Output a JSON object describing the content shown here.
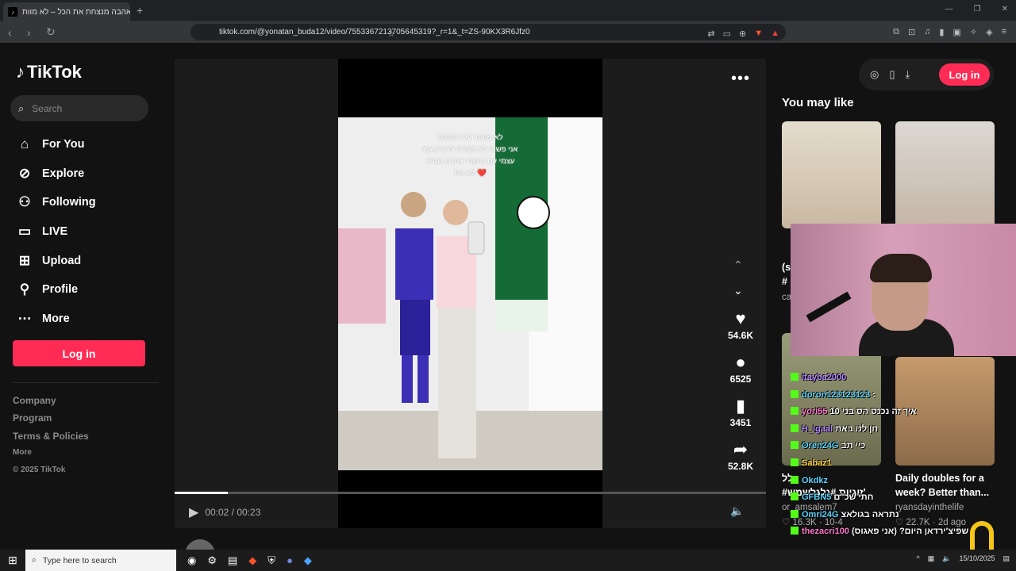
{
  "browser": {
    "tab_title": "אהבה מנצחת את הכל – לא מוות",
    "tab_icon": "tiktok-favicon",
    "url": "tiktok.com/@yonatan_buda12/video/7553367213705645319?_r=1&_t=ZS-90KX3R6Jfz0"
  },
  "sidebar": {
    "logo": "TikTok",
    "search_placeholder": "Search",
    "menu": [
      {
        "label": "For You",
        "icon": "home-icon"
      },
      {
        "label": "Explore",
        "icon": "compass-icon"
      },
      {
        "label": "Following",
        "icon": "following-icon"
      },
      {
        "label": "LIVE",
        "icon": "live-icon"
      },
      {
        "label": "Upload",
        "icon": "upload-icon"
      },
      {
        "label": "Profile",
        "icon": "profile-icon"
      },
      {
        "label": "More",
        "icon": "more-icon"
      }
    ],
    "login_label": "Log in",
    "footer": [
      "Company",
      "Program",
      "Terms & Policies",
      "More",
      "© 2025 TikTok"
    ]
  },
  "video": {
    "caption_lines": [
      "לא מוותר עליו לעולם",
      "אני פשוט לא מצליח לדמיין את",
      "עצמי עם מישהי אחרת שהיא",
      "לא את ❤️"
    ],
    "likes": "54.6K",
    "comments": "6525",
    "saves": "3451",
    "shares": "52.8K",
    "time": "00:02 / 00:23",
    "progress": 0.09,
    "author": "yonatan_buda12"
  },
  "header": {
    "login_label": "Log in"
  },
  "you_may_like": {
    "title": "You may like",
    "cards": [
      {
        "title": "Daily doubles for a week? Better than...",
        "author": "ryansdayinthelife",
        "likes": "22.7K",
        "age": "2d ago"
      }
    ],
    "partial": [
      "(s",
      "#",
      "ca",
      "לל",
      "#זוגיות #גלגלשמש'",
      "or_amsalem7",
      "16.3K",
      "10-4"
    ]
  },
  "chat": [
    {
      "user": "itayba2000",
      "msg": ""
    },
    {
      "user": "doron123123123",
      "msg": ":"
    },
    {
      "user": "yori55",
      "msg": "איך זה נכנס הס בני 10"
    },
    {
      "user": "H_Igaal",
      "msg": "חן לנו באת"
    },
    {
      "user": "Oren24G",
      "msg": "כיי תב"
    },
    {
      "user": "Sabaz1",
      "msg": ""
    },
    {
      "user": "Okdkz",
      "msg": ""
    },
    {
      "user": "GFBN5",
      "msg": "חתי שכ\"ם"
    },
    {
      "user": "Omri24G",
      "msg": "נתראה בגולאצ"
    },
    {
      "user": "thezacri100",
      "msg": "שפיצ'ירדאן היום? (אני פאגוס)"
    }
  ],
  "taskbar": {
    "search_placeholder": "Type here to search",
    "date": "15/10/2025"
  }
}
